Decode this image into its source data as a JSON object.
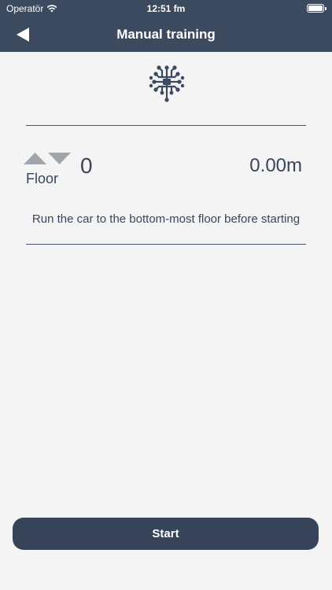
{
  "status_bar": {
    "carrier": "Operatör",
    "time": "12:51 fm"
  },
  "nav": {
    "title": "Manual training",
    "back_icon": "back-arrow-icon"
  },
  "header_icon": "brain-circuit-icon",
  "floor": {
    "label": "Floor",
    "value": "0",
    "position": "0.00m",
    "up_icon": "arrow-up-icon",
    "down_icon": "arrow-down-icon"
  },
  "instruction": "Run the car to the bottom-most floor before starting",
  "start_label": "Start",
  "colors": {
    "header_bg": "#3b4a5f",
    "page_bg": "#f4f4f4",
    "text": "#3a4558",
    "arrow_gray": "#a0a4ab",
    "button_bg": "#364358"
  }
}
